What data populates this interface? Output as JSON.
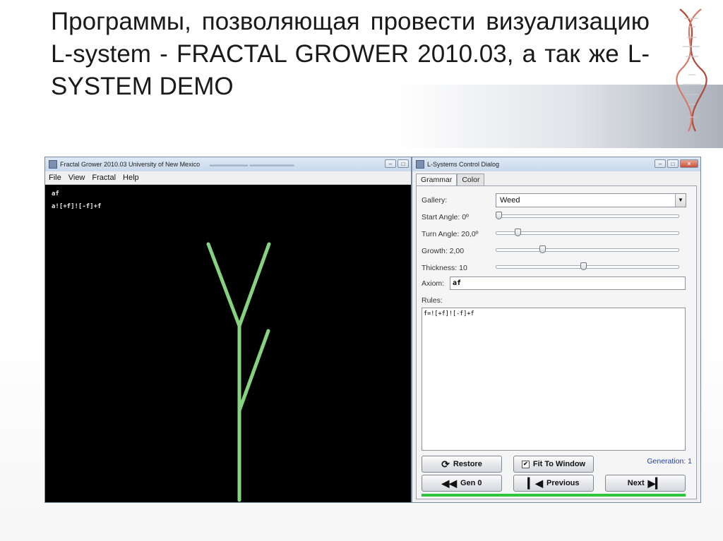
{
  "slide": {
    "title": "Программы, позволяющая провести визуализацию L-system - FRACTAL GROWER 2010.03, а так же L-SYSTEM DEMO"
  },
  "fractal_window": {
    "title": "Fractal Grower 2010.03 University of New Mexico",
    "menu": [
      "File",
      "View",
      "Fractal",
      "Help"
    ],
    "axiom_text": "af",
    "expansion_text": "a![+f]![-f]+f",
    "plant_color": "#86d27e",
    "canvas_color": "#000000"
  },
  "control_dialog": {
    "title": "L-Systems Control Dialog",
    "tabs": [
      "Grammar",
      "Color"
    ],
    "gallery": {
      "label": "Gallery:",
      "value": "Weed"
    },
    "sliders": {
      "start_angle": {
        "label": "Start Angle: 0º",
        "value": 0
      },
      "turn_angle": {
        "label": "Turn Angle: 20,0º",
        "value": 0.11
      },
      "growth": {
        "label": "Growth: 2,00",
        "value": 0.25
      },
      "thickness": {
        "label": "Thickness: 10",
        "value": 0.48
      }
    },
    "axiom": {
      "label": "Axiom:",
      "value": "af"
    },
    "rules": {
      "label": "Rules:",
      "value": "f=![+f]![-f]+f"
    },
    "buttons": {
      "restore": "Restore",
      "fit_to_window": "Fit To Window",
      "gen0": "Gen 0",
      "previous": "Previous",
      "next": "Next"
    },
    "fit_to_window_checked": true,
    "generation": "Generation: 1",
    "progress": 1.0,
    "accent_color": "#2fc63d"
  }
}
